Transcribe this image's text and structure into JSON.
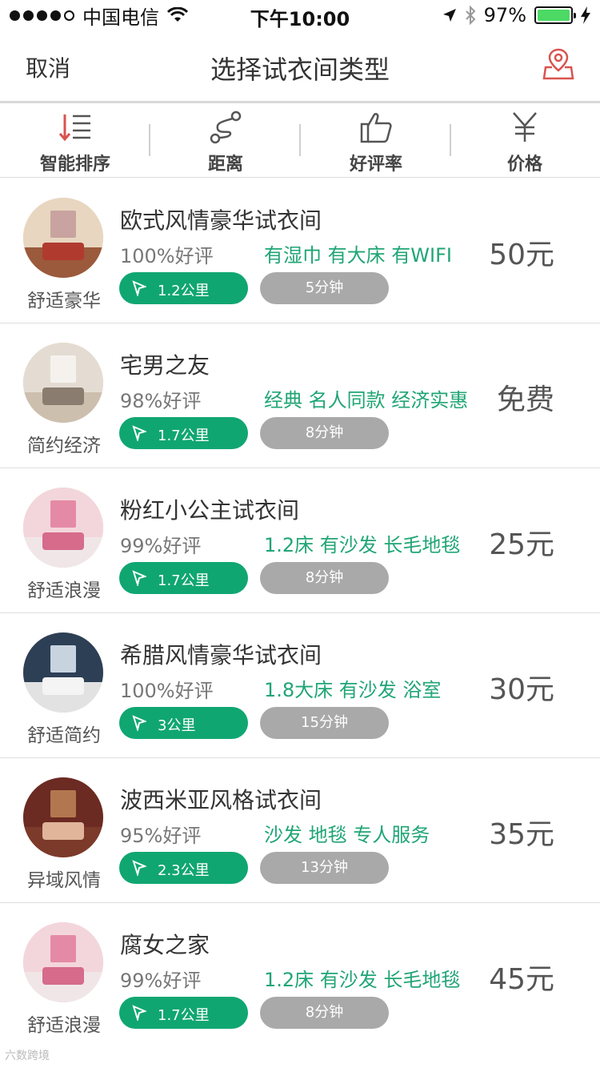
{
  "status_bar": {
    "carrier": "中国电信",
    "time": "下午10:00",
    "battery": "97%",
    "battery_color": "#4cd964"
  },
  "nav": {
    "cancel": "取消",
    "title": "选择试衣间类型",
    "right_icon": "location-pin-icon"
  },
  "filters": [
    {
      "label": "智能排序",
      "icon": "sort-icon"
    },
    {
      "label": "距离",
      "icon": "route-icon"
    },
    {
      "label": "好评率",
      "icon": "thumbs-up-icon"
    },
    {
      "label": "价格",
      "icon": "yen-icon"
    }
  ],
  "rooms": [
    {
      "name": "欧式风情豪华试衣间",
      "category": "舒适豪华",
      "rating": "100%好评",
      "tags": "有湿巾 有大床 有WIFI",
      "distance": "1.2公里",
      "time": "5分钟",
      "price": "50元"
    },
    {
      "name": "宅男之友",
      "category": "简约经济",
      "rating": "98%好评",
      "tags": "经典 名人同款 经济实惠",
      "distance": "1.7公里",
      "time": "8分钟",
      "price": "免费"
    },
    {
      "name": "粉红小公主试衣间",
      "category": "舒适浪漫",
      "rating": "99%好评",
      "tags": "1.2床 有沙发 长毛地毯",
      "distance": "1.7公里",
      "time": "8分钟",
      "price": "25元"
    },
    {
      "name": "希腊风情豪华试衣间",
      "category": "舒适简约",
      "rating": "100%好评",
      "tags": "1.8大床 有沙发 浴室",
      "distance": "3公里",
      "time": "15分钟",
      "price": "30元"
    },
    {
      "name": "波西米亚风格试衣间",
      "category": "异域风情",
      "rating": "95%好评",
      "tags": "沙发 地毯 专人服务",
      "distance": "2.3公里",
      "time": "13分钟",
      "price": "35元"
    },
    {
      "name": "腐女之家",
      "category": "舒适浪漫",
      "rating": "99%好评",
      "tags": "1.2床 有沙发 长毛地毯",
      "distance": "1.7公里",
      "time": "8分钟",
      "price": "45元"
    }
  ],
  "colors": {
    "accent_green": "#10a672",
    "tag_green": "#20a576",
    "pill_gray": "#a9a9a9",
    "icon_red": "#d9534f"
  },
  "watermark": "六数跨境"
}
